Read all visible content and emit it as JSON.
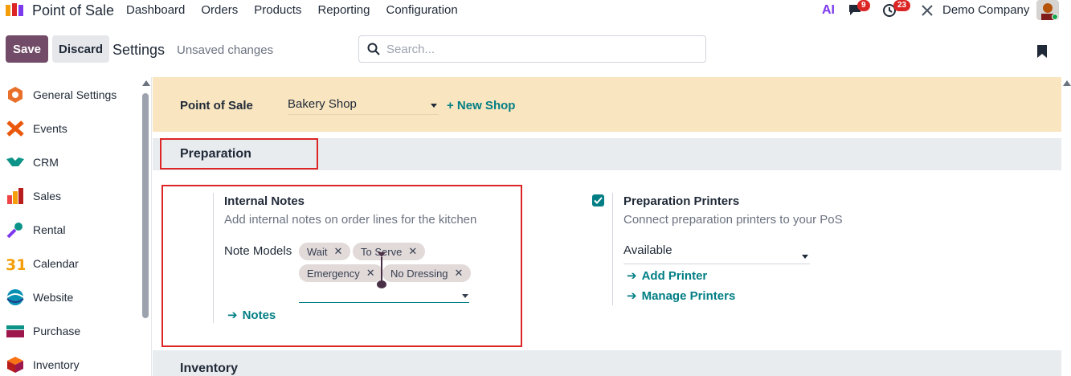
{
  "topnav": {
    "app_name": "Point of Sale",
    "menu": [
      "Dashboard",
      "Orders",
      "Products",
      "Reporting",
      "Configuration"
    ],
    "ai_label": "AI",
    "messages_count": "9",
    "activities_count": "23",
    "company": "Demo Company"
  },
  "controlbar": {
    "save_label": "Save",
    "discard_label": "Discard",
    "title": "Settings",
    "status": "Unsaved changes",
    "search_placeholder": "Search..."
  },
  "sidebar": {
    "items": [
      {
        "label": "General Settings",
        "icon": "general-settings-icon"
      },
      {
        "label": "Events",
        "icon": "events-icon"
      },
      {
        "label": "CRM",
        "icon": "crm-icon"
      },
      {
        "label": "Sales",
        "icon": "sales-icon"
      },
      {
        "label": "Rental",
        "icon": "rental-icon"
      },
      {
        "label": "Calendar",
        "icon": "calendar-icon"
      },
      {
        "label": "Website",
        "icon": "website-icon"
      },
      {
        "label": "Purchase",
        "icon": "purchase-icon"
      },
      {
        "label": "Inventory",
        "icon": "inventory-icon"
      }
    ],
    "calendar_day": "31"
  },
  "main": {
    "pos_label": "Point of Sale",
    "shop_value": "Bakery Shop",
    "new_shop_label": "+ New Shop",
    "sections": {
      "preparation": "Preparation",
      "inventory": "Inventory"
    },
    "internal_notes": {
      "title": "Internal Notes",
      "description": "Add internal notes on order lines for the kitchen",
      "note_models_label": "Note Models",
      "tags": [
        "Wait",
        "To Serve",
        "Emergency",
        "No Dressing"
      ],
      "notes_link": "Notes"
    },
    "preparation_printers": {
      "checked": true,
      "title": "Preparation Printers",
      "description": "Connect preparation printers to your PoS",
      "select_value": "Available",
      "add_printer": "Add Printer",
      "manage_printers": "Manage Printers"
    }
  },
  "colors": {
    "primary": "#714b67",
    "accent": "#017e84",
    "banner": "#f9e5c0",
    "highlight": "#dc2626"
  }
}
